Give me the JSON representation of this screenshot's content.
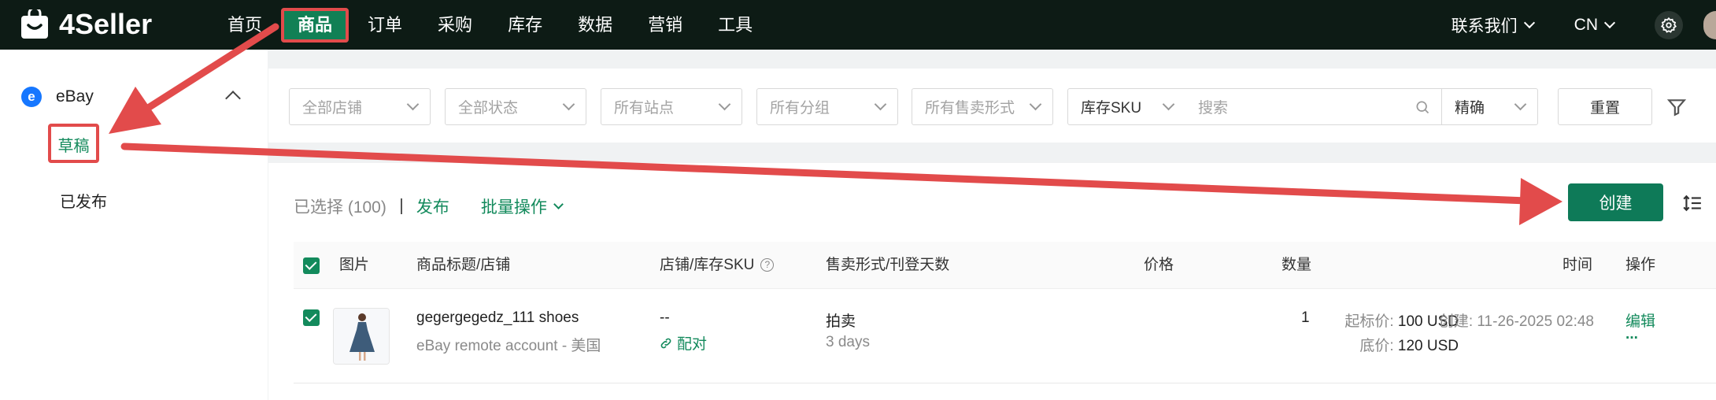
{
  "header": {
    "logo_text": "4Seller",
    "nav": [
      "首页",
      "商品",
      "订单",
      "采购",
      "库存",
      "数据",
      "营销",
      "工具"
    ],
    "active_nav": "商品",
    "contact_label": "联系我们",
    "lang_label": "CN"
  },
  "sidebar": {
    "platform_logo_letter": "e",
    "platform_label": "eBay",
    "items": [
      {
        "label": "草稿",
        "active": true
      },
      {
        "label": "已发布",
        "active": false
      }
    ]
  },
  "filters": {
    "store": "全部店铺",
    "status": "全部状态",
    "site": "所有站点",
    "group": "所有分组",
    "sale_format": "所有售卖形式",
    "search_field": "库存SKU",
    "search_placeholder": "搜索",
    "match_mode": "精确",
    "reset_label": "重置"
  },
  "toolbar": {
    "selected_text": "已选择 (100)",
    "separator": "|",
    "publish_label": "发布",
    "batch_label": "批量操作",
    "create_label": "创建"
  },
  "table": {
    "columns": {
      "image": "图片",
      "title_store": "商品标题/店铺",
      "store_sku": "店铺/库存SKU",
      "format_days": "售卖形式/刊登天数",
      "price": "价格",
      "qty": "数量",
      "time": "时间",
      "actions": "操作"
    },
    "rows": [
      {
        "title": "gegergegedz_111 shoes",
        "store": "eBay remote account - 美国",
        "sku": "--",
        "pair_label": "配对",
        "format": "拍卖",
        "days": "3 days",
        "start_price_label": "起标价:",
        "start_price": "100 USD",
        "reserve_price_label": "底价:",
        "reserve_price": "120 USD",
        "qty": "1",
        "time_label": "创建:",
        "time": "11-26-2025 02:48",
        "edit_label": "编辑",
        "more_label": "···"
      }
    ]
  },
  "colors": {
    "brand_green": "#138a5c",
    "button_green": "#0e7a58",
    "topbar_bg": "#0d1b15",
    "annotation_red": "#e24b4b"
  }
}
